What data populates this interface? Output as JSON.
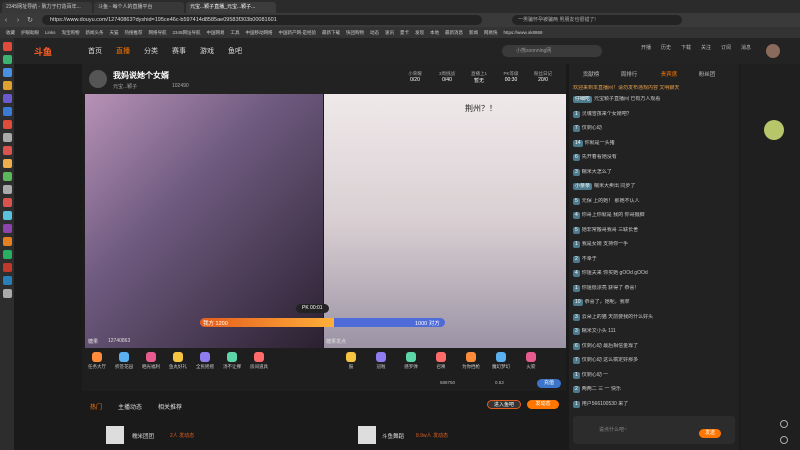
{
  "browser": {
    "tabs": [
      "2345网址导航 - 致力于打造百年...",
      "斗鱼 - 每个人的直播平台",
      "元宝...颖子直播_元宝...颖子..."
    ],
    "url": "https://www.douyu.com/12740863?dyshid=195ce46c-b597414d8585ae09583f303b00081601",
    "search_placeholder": "一男骗怀孕被骗两 男朋友也很错了!",
    "bookmarks": [
      "收藏",
      "护眼助眼",
      "Links",
      "淘宝购物",
      "新闻头条",
      "天猫",
      "热搜推荐",
      "网络导航",
      "2345网址导航",
      "中国网易",
      "工具",
      "中国移动网络",
      "中国新产网-是经验",
      "最新下载",
      "快团购物",
      "动态",
      "速讯",
      "夏卡",
      "发现",
      "本地",
      "最新消息",
      "新闻",
      "网易快",
      "https://www.ok8868"
    ]
  },
  "nav": {
    "logo": "斗鱼",
    "items": [
      "首页",
      "直播",
      "分类",
      "赛事",
      "游戏",
      "鱼吧"
    ],
    "search_placeholder": "小熊soonning网",
    "right_icons": [
      "开播",
      "历史",
      "下载",
      "关注",
      "订阅",
      "消息"
    ]
  },
  "room": {
    "title": "我妈说她个女婿",
    "streamer": "元宝...颖子",
    "viewers": "102490",
    "stats": [
      {
        "label": "小荣耀",
        "value": "0/20"
      },
      {
        "label": "3周挑战",
        "value": "0/40"
      },
      {
        "label": "直播上1",
        "value": "暂无"
      },
      {
        "label": "PK等级",
        "value": "00:30"
      },
      {
        "label": "粉丝日记",
        "value": "20/0"
      }
    ],
    "overlay_text": "荆州？！",
    "pk": {
      "left_label": "我方 1200",
      "right_label": "1000 对方",
      "timer": "PK 00:01",
      "left_ratio": 0.545
    },
    "room_id": "12740863",
    "bottom_left": "糖果",
    "bottom_right": "糖果发点"
  },
  "gifts_left": [
    "任务大厅",
    "折签花园",
    "晒光福利",
    "鱼丸好礼",
    "全民摇摇",
    "汤不让撑",
    "房间道具"
  ],
  "gifts_right": [
    "鼓",
    "冠啦",
    "感罗弹",
    "召唤",
    "为你挡枪",
    "魔幻梦幻",
    "火箭"
  ],
  "gift_stats": {
    "fish_balls": "588750",
    "fish_cards": "0.53",
    "recharge": "充值"
  },
  "bottom": {
    "tabs": [
      "热门",
      "主播动态",
      "相关推荐"
    ],
    "buttons": [
      "进入鱼吧",
      "发动态"
    ],
    "cards": [
      {
        "name": "糯米团团",
        "meta": "2人 发动态"
      },
      {
        "name": "斗鱼舞蹈",
        "meta": "8.9w人 发动态"
      }
    ]
  },
  "chat": {
    "tabs": [
      "贡献榜",
      "周排行",
      "贵宾席",
      "粉丝团"
    ],
    "notice": "欢迎来到本直播间！请勿发布违规内容 文明聊天",
    "messages": [
      {
        "badge": "仔细吃",
        "text": "元宝颖子直播间 已有万人观看"
      },
      {
        "badge": "1",
        "text": "灵魂雪孩来个女婿吧？"
      },
      {
        "badge": "7",
        "text": "仅剩心动"
      },
      {
        "badge": "14",
        "text": "你就是一头猪"
      },
      {
        "badge": "6",
        "text": "先开着看她没有"
      },
      {
        "badge": "3",
        "text": "糯米大怎么了"
      },
      {
        "badge": "小亲亲",
        "text": "糯米大卖出 同步了"
      },
      {
        "badge": "5",
        "text": "元保 上的她！ 那她不认人"
      },
      {
        "badge": "4",
        "text": "你哥上你就是 我的 你哥摄脚"
      },
      {
        "badge": "5",
        "text": "她非常搬哥我哥 三联长舍"
      },
      {
        "badge": "1",
        "text": "我是女婿 支持你一手"
      },
      {
        "badge": "2",
        "text": "不幸于"
      },
      {
        "badge": "4",
        "text": "你姐夫来 你买她 gOOd gOOd"
      },
      {
        "badge": "1",
        "text": "你姐很漂亮 获得了 恭喜！"
      },
      {
        "badge": "10",
        "text": "恭喜了，她呢，我拿"
      },
      {
        "badge": "3",
        "text": "云朵上的猫 天前要我的什么好头"
      },
      {
        "badge": "3",
        "text": "糯米文小头 111"
      },
      {
        "badge": "6",
        "text": "仅剩心动 最后相信金靠了"
      },
      {
        "badge": "7",
        "text": "仅剩心动 这么搞定好那多"
      },
      {
        "badge": "1",
        "text": "仅剩心动 一"
      },
      {
        "badge": "2",
        "text": "两两二 三 一 快乐"
      },
      {
        "badge": "1",
        "text": "用户566100530 来了"
      }
    ],
    "input_placeholder": "说点什么吧~",
    "send": "发送"
  }
}
